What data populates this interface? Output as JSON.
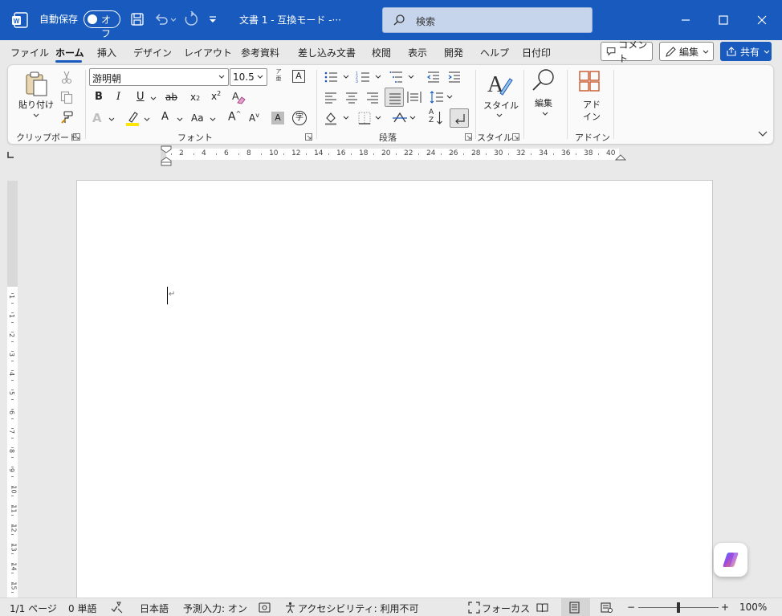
{
  "titlebar": {
    "autosave_label": "自動保存",
    "autosave_state": "オフ",
    "doc_title": "文書 1  -  互換モード  -···",
    "search_placeholder": "検索"
  },
  "tabs": [
    {
      "label": "ファイル"
    },
    {
      "label": "ホーム"
    },
    {
      "label": "挿入"
    },
    {
      "label": "デザイン"
    },
    {
      "label": "レイアウト"
    },
    {
      "label": "参考資料"
    },
    {
      "label": "差し込み文書"
    },
    {
      "label": "校閲"
    },
    {
      "label": "表示"
    },
    {
      "label": "開発"
    },
    {
      "label": "ヘルプ"
    },
    {
      "label": "日付印"
    }
  ],
  "actions": {
    "comment": "コメント",
    "edit": "編集",
    "share": "共有"
  },
  "ribbon": {
    "clipboard": {
      "paste_label": "貼り付け",
      "group_label": "クリップボード"
    },
    "font": {
      "font_name": "游明朝",
      "font_size": "10.5",
      "group_label": "フォント",
      "bold": "B",
      "italic": "I",
      "underline": "U",
      "strike": "ab",
      "subscript": "x",
      "superscript": "x",
      "text_effect": "A",
      "font_color": "A",
      "change_case": "Aa",
      "grow": "A",
      "shrink": "A",
      "char_shading": "A",
      "enclose": "字",
      "char_border": "A",
      "phonetic_top": "ア",
      "phonetic_bottom": "亜"
    },
    "paragraph": {
      "group_label": "段落",
      "sort_top": "A",
      "sort_bottom": "Z"
    },
    "styles": {
      "button_label": "スタイル",
      "group_label": "スタイル"
    },
    "editing": {
      "button_label": "編集"
    },
    "addin": {
      "button_label_1": "アド",
      "button_label_2": "イン",
      "group_label": "アドイン"
    }
  },
  "ruler": {
    "numbers": [
      "2",
      "4",
      "6",
      "8",
      "10",
      "12",
      "14",
      "16",
      "18",
      "20",
      "22",
      "24",
      "26",
      "28",
      "30",
      "32",
      "34",
      "36",
      "38",
      "40"
    ],
    "vertical_numbers": [
      "1",
      "1",
      "2",
      "3",
      "4",
      "5",
      "6",
      "7",
      "8",
      "9",
      "10",
      "11",
      "12",
      "13",
      "14",
      "15",
      "16"
    ]
  },
  "document": {
    "paragraph_mark": "↵"
  },
  "statusbar": {
    "page": "1/1 ページ",
    "words": "0 単語",
    "language": "日本語",
    "predictive": "予測入力: オン",
    "accessibility": "アクセシビリティ: 利用不可",
    "focus": "フォーカス",
    "zoom_minus": "−",
    "zoom_plus": "+",
    "zoom": "100%",
    "zoom_level": 1.0
  },
  "colors": {
    "accent": "#185abd",
    "highlight": "#ffe600",
    "font_color_bar": "#d13438"
  }
}
